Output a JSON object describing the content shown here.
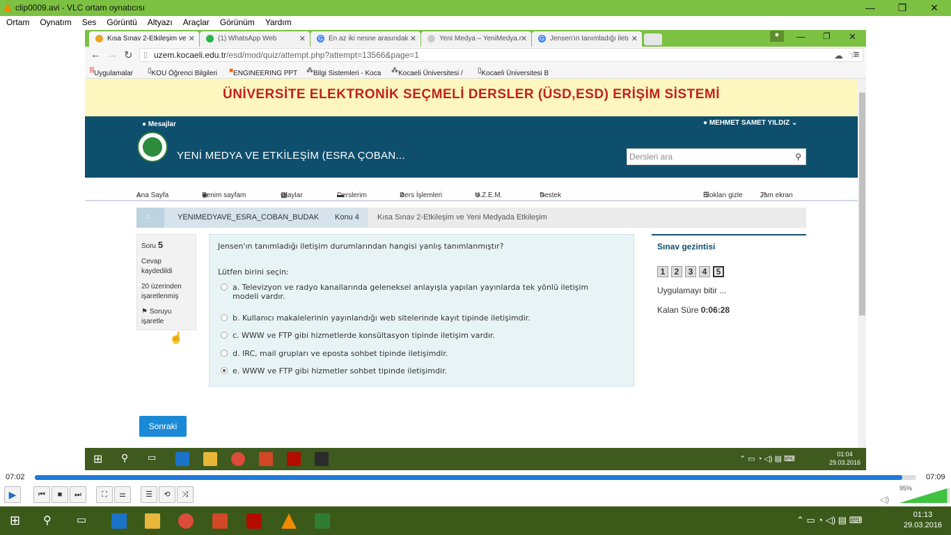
{
  "vlc": {
    "title": "clip0009.avi - VLC ortam oynatıcısı",
    "menu": [
      "Ortam",
      "Oynatım",
      "Ses",
      "Görüntü",
      "Altyazı",
      "Araçlar",
      "Görünüm",
      "Yardım"
    ],
    "time_elapsed": "07:02",
    "time_total": "07:09",
    "progress": 0.984,
    "volume": "95%"
  },
  "browser": {
    "tabs": [
      {
        "label": "Kısa Sınav 2-Etkileşim ve",
        "color": "#e8a628"
      },
      {
        "label": "(1) WhatsApp Web",
        "color": "#29b34a"
      },
      {
        "label": "En az iki nesne arasındak",
        "color": "#4285f4"
      },
      {
        "label": "Yeni Medya – YeniMedya.r",
        "color": "#cccccc"
      },
      {
        "label": "Jensen'ın tanımladığı iletı",
        "color": "#4285f4"
      }
    ],
    "url_host": "uzem.kocaeli.edu.tr",
    "url_path": "/esd/mod/quiz/attempt.php?attempt=13566&page=1",
    "bookmarks": [
      "Uygulamalar",
      "KOU Öğrenci Bilgileri",
      "ENGINEERING PPT",
      "Bilgi Sistemleri - Koca",
      "Kocaeli Üniversitesi /",
      "Kocaeli Üniversitesi B"
    ]
  },
  "site": {
    "banner": "ÜNİVERSİTE ELEKTRONİK SEÇMELİ DERSLER (ÜSD,ESD) ERİŞİM SİSTEMİ",
    "messages": "Mesajlar",
    "user": "MEHMET SAMET YILDIZ",
    "course_title": "YENİ MEDYA VE ETKİLEŞİM (ESRA ÇOBAN...",
    "search_placeholder": "Dersleri ara",
    "nav": [
      "Ana Sayfa",
      "Benim sayfam",
      "Olaylar",
      "Derslerim",
      "Ders İşlemleri",
      "U.Z.E.M.",
      "Destek"
    ],
    "hide_blocks": "Blokları gizle",
    "fullscreen": "Tam ekran",
    "breadcrumb": [
      "YENIMEDYAVE_ESRA_COBAN_BUDAK",
      "Konu 4",
      "Kısa Sınav 2-Etkileşim ve Yeni Medyada Etkileşim"
    ]
  },
  "question": {
    "label": "Soru",
    "number": "5",
    "status": "Cevap kaydedildi",
    "marks": "20 üzerinden işaretlenmiş",
    "flag": "Soruyu işaretle",
    "text": "Jensen'ın tanımladığı iletişim durumlarından hangisi yanlış tanımlanmıştır?",
    "prompt": "Lütfen birini seçin:",
    "options": [
      {
        "line1": "a. Televizyon ve radyo kanallarında geleneksel anlayışla yapılan yayınlarda tek yönlü iletişim",
        "line2": "modeli vardır."
      },
      {
        "line1": "b. Kullanıcı makalelerinin yayınlandığı web sitelerinde kayıt tipinde iletişimdir."
      },
      {
        "line1": "c. WWW ve FTP gibi hizmetlerde konsültasyon tipinde iletişim vardır."
      },
      {
        "line1": "d. IRC, mail grupları ve eposta sohbet tipinde iletişimdir."
      },
      {
        "line1": "e. WWW ve FTP gibi hizmetler sohbet tipinde iletişimdir."
      }
    ],
    "selected": "e",
    "next_button": "Sonraki"
  },
  "quiz_nav": {
    "title": "Sınav gezintisi",
    "pages": [
      "1",
      "2",
      "3",
      "4",
      "5"
    ],
    "current_page": "5",
    "finish": "Uygulamayı bitir ...",
    "time_label": "Kalan Süre",
    "time_value": "0:06:28"
  },
  "inner_taskbar": {
    "time": "01:04",
    "date": "29.03.2016"
  },
  "taskbar": {
    "time": "01:13",
    "date": "29.03.2016"
  }
}
